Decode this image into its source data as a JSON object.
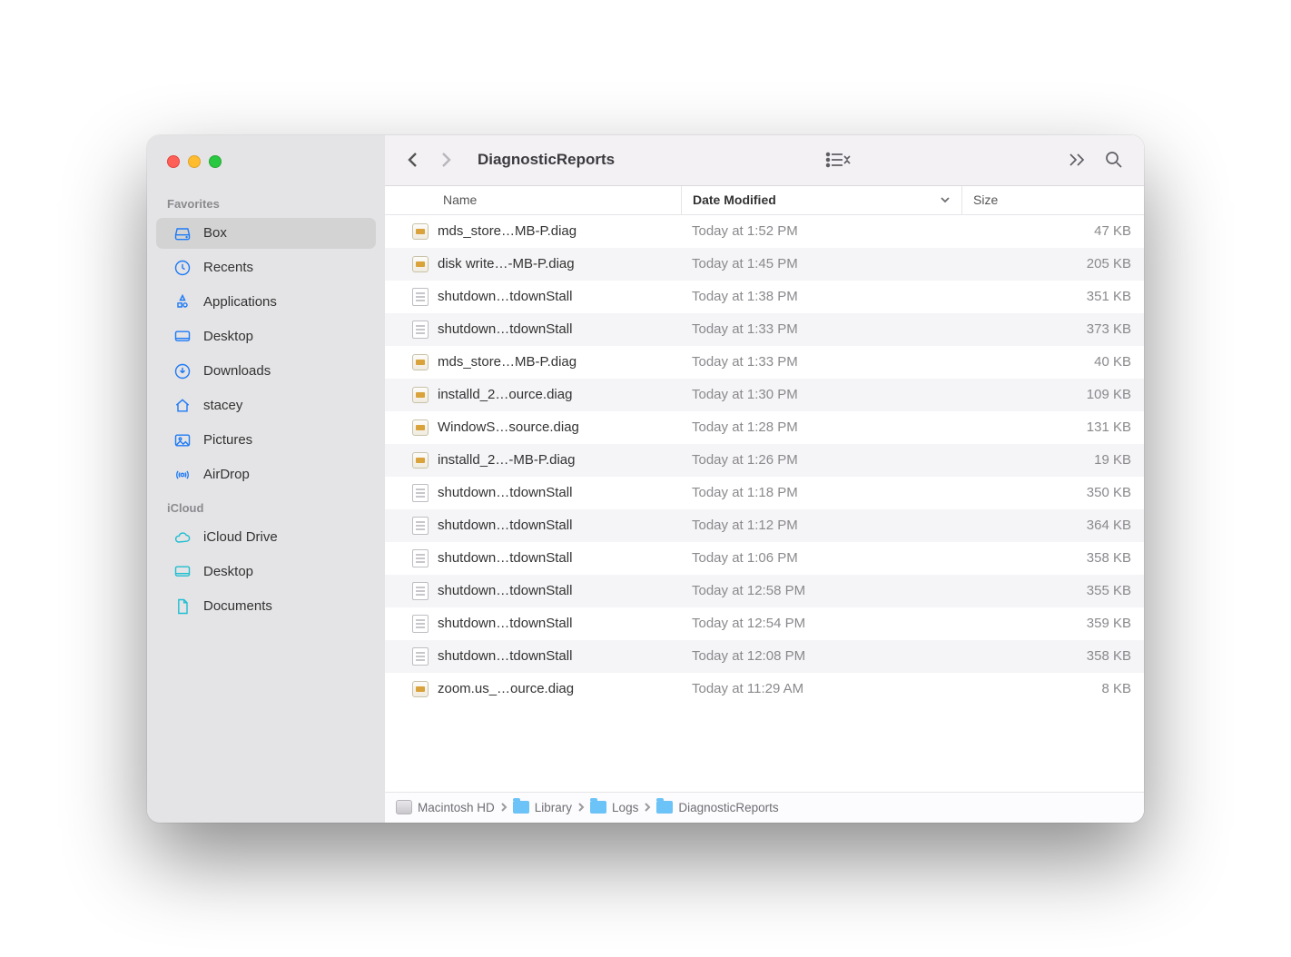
{
  "window": {
    "title": "DiagnosticReports"
  },
  "sidebar": {
    "sections": [
      {
        "label": "Favorites",
        "items": [
          {
            "label": "Box",
            "icon": "disk"
          },
          {
            "label": "Recents",
            "icon": "clock"
          },
          {
            "label": "Applications",
            "icon": "apps"
          },
          {
            "label": "Desktop",
            "icon": "desktop"
          },
          {
            "label": "Downloads",
            "icon": "download"
          },
          {
            "label": "stacey",
            "icon": "home"
          },
          {
            "label": "Pictures",
            "icon": "pictures"
          },
          {
            "label": "AirDrop",
            "icon": "airdrop"
          }
        ]
      },
      {
        "label": "iCloud",
        "items": [
          {
            "label": "iCloud Drive",
            "icon": "cloud"
          },
          {
            "label": "Desktop",
            "icon": "desktop-teal"
          },
          {
            "label": "Documents",
            "icon": "document-teal"
          }
        ]
      }
    ]
  },
  "columns": {
    "name": "Name",
    "date": "Date Modified",
    "size": "Size"
  },
  "files": [
    {
      "name": "mds_store…MB-P.diag",
      "date": "Today at 1:52 PM",
      "size": "47 KB",
      "icon": "diag"
    },
    {
      "name": "disk write…-MB-P.diag",
      "date": "Today at 1:45 PM",
      "size": "205 KB",
      "icon": "diag"
    },
    {
      "name": "shutdown…tdownStall",
      "date": "Today at 1:38 PM",
      "size": "351 KB",
      "icon": "text"
    },
    {
      "name": "shutdown…tdownStall",
      "date": "Today at 1:33 PM",
      "size": "373 KB",
      "icon": "text"
    },
    {
      "name": "mds_store…MB-P.diag",
      "date": "Today at 1:33 PM",
      "size": "40 KB",
      "icon": "diag"
    },
    {
      "name": "installd_2…ource.diag",
      "date": "Today at 1:30 PM",
      "size": "109 KB",
      "icon": "diag"
    },
    {
      "name": "WindowS…source.diag",
      "date": "Today at 1:28 PM",
      "size": "131 KB",
      "icon": "diag"
    },
    {
      "name": "installd_2…-MB-P.diag",
      "date": "Today at 1:26 PM",
      "size": "19 KB",
      "icon": "diag"
    },
    {
      "name": "shutdown…tdownStall",
      "date": "Today at 1:18 PM",
      "size": "350 KB",
      "icon": "text"
    },
    {
      "name": "shutdown…tdownStall",
      "date": "Today at 1:12 PM",
      "size": "364 KB",
      "icon": "text"
    },
    {
      "name": "shutdown…tdownStall",
      "date": "Today at 1:06 PM",
      "size": "358 KB",
      "icon": "text"
    },
    {
      "name": "shutdown…tdownStall",
      "date": "Today at 12:58 PM",
      "size": "355 KB",
      "icon": "text"
    },
    {
      "name": "shutdown…tdownStall",
      "date": "Today at 12:54 PM",
      "size": "359 KB",
      "icon": "text"
    },
    {
      "name": "shutdown…tdownStall",
      "date": "Today at 12:08 PM",
      "size": "358 KB",
      "icon": "text"
    },
    {
      "name": "zoom.us_…ource.diag",
      "date": "Today at 11:29 AM",
      "size": "8 KB",
      "icon": "diag"
    }
  ],
  "path": [
    {
      "label": "Macintosh HD",
      "icon": "disk"
    },
    {
      "label": "Library",
      "icon": "folder"
    },
    {
      "label": "Logs",
      "icon": "folder"
    },
    {
      "label": "DiagnosticReports",
      "icon": "folder"
    }
  ]
}
